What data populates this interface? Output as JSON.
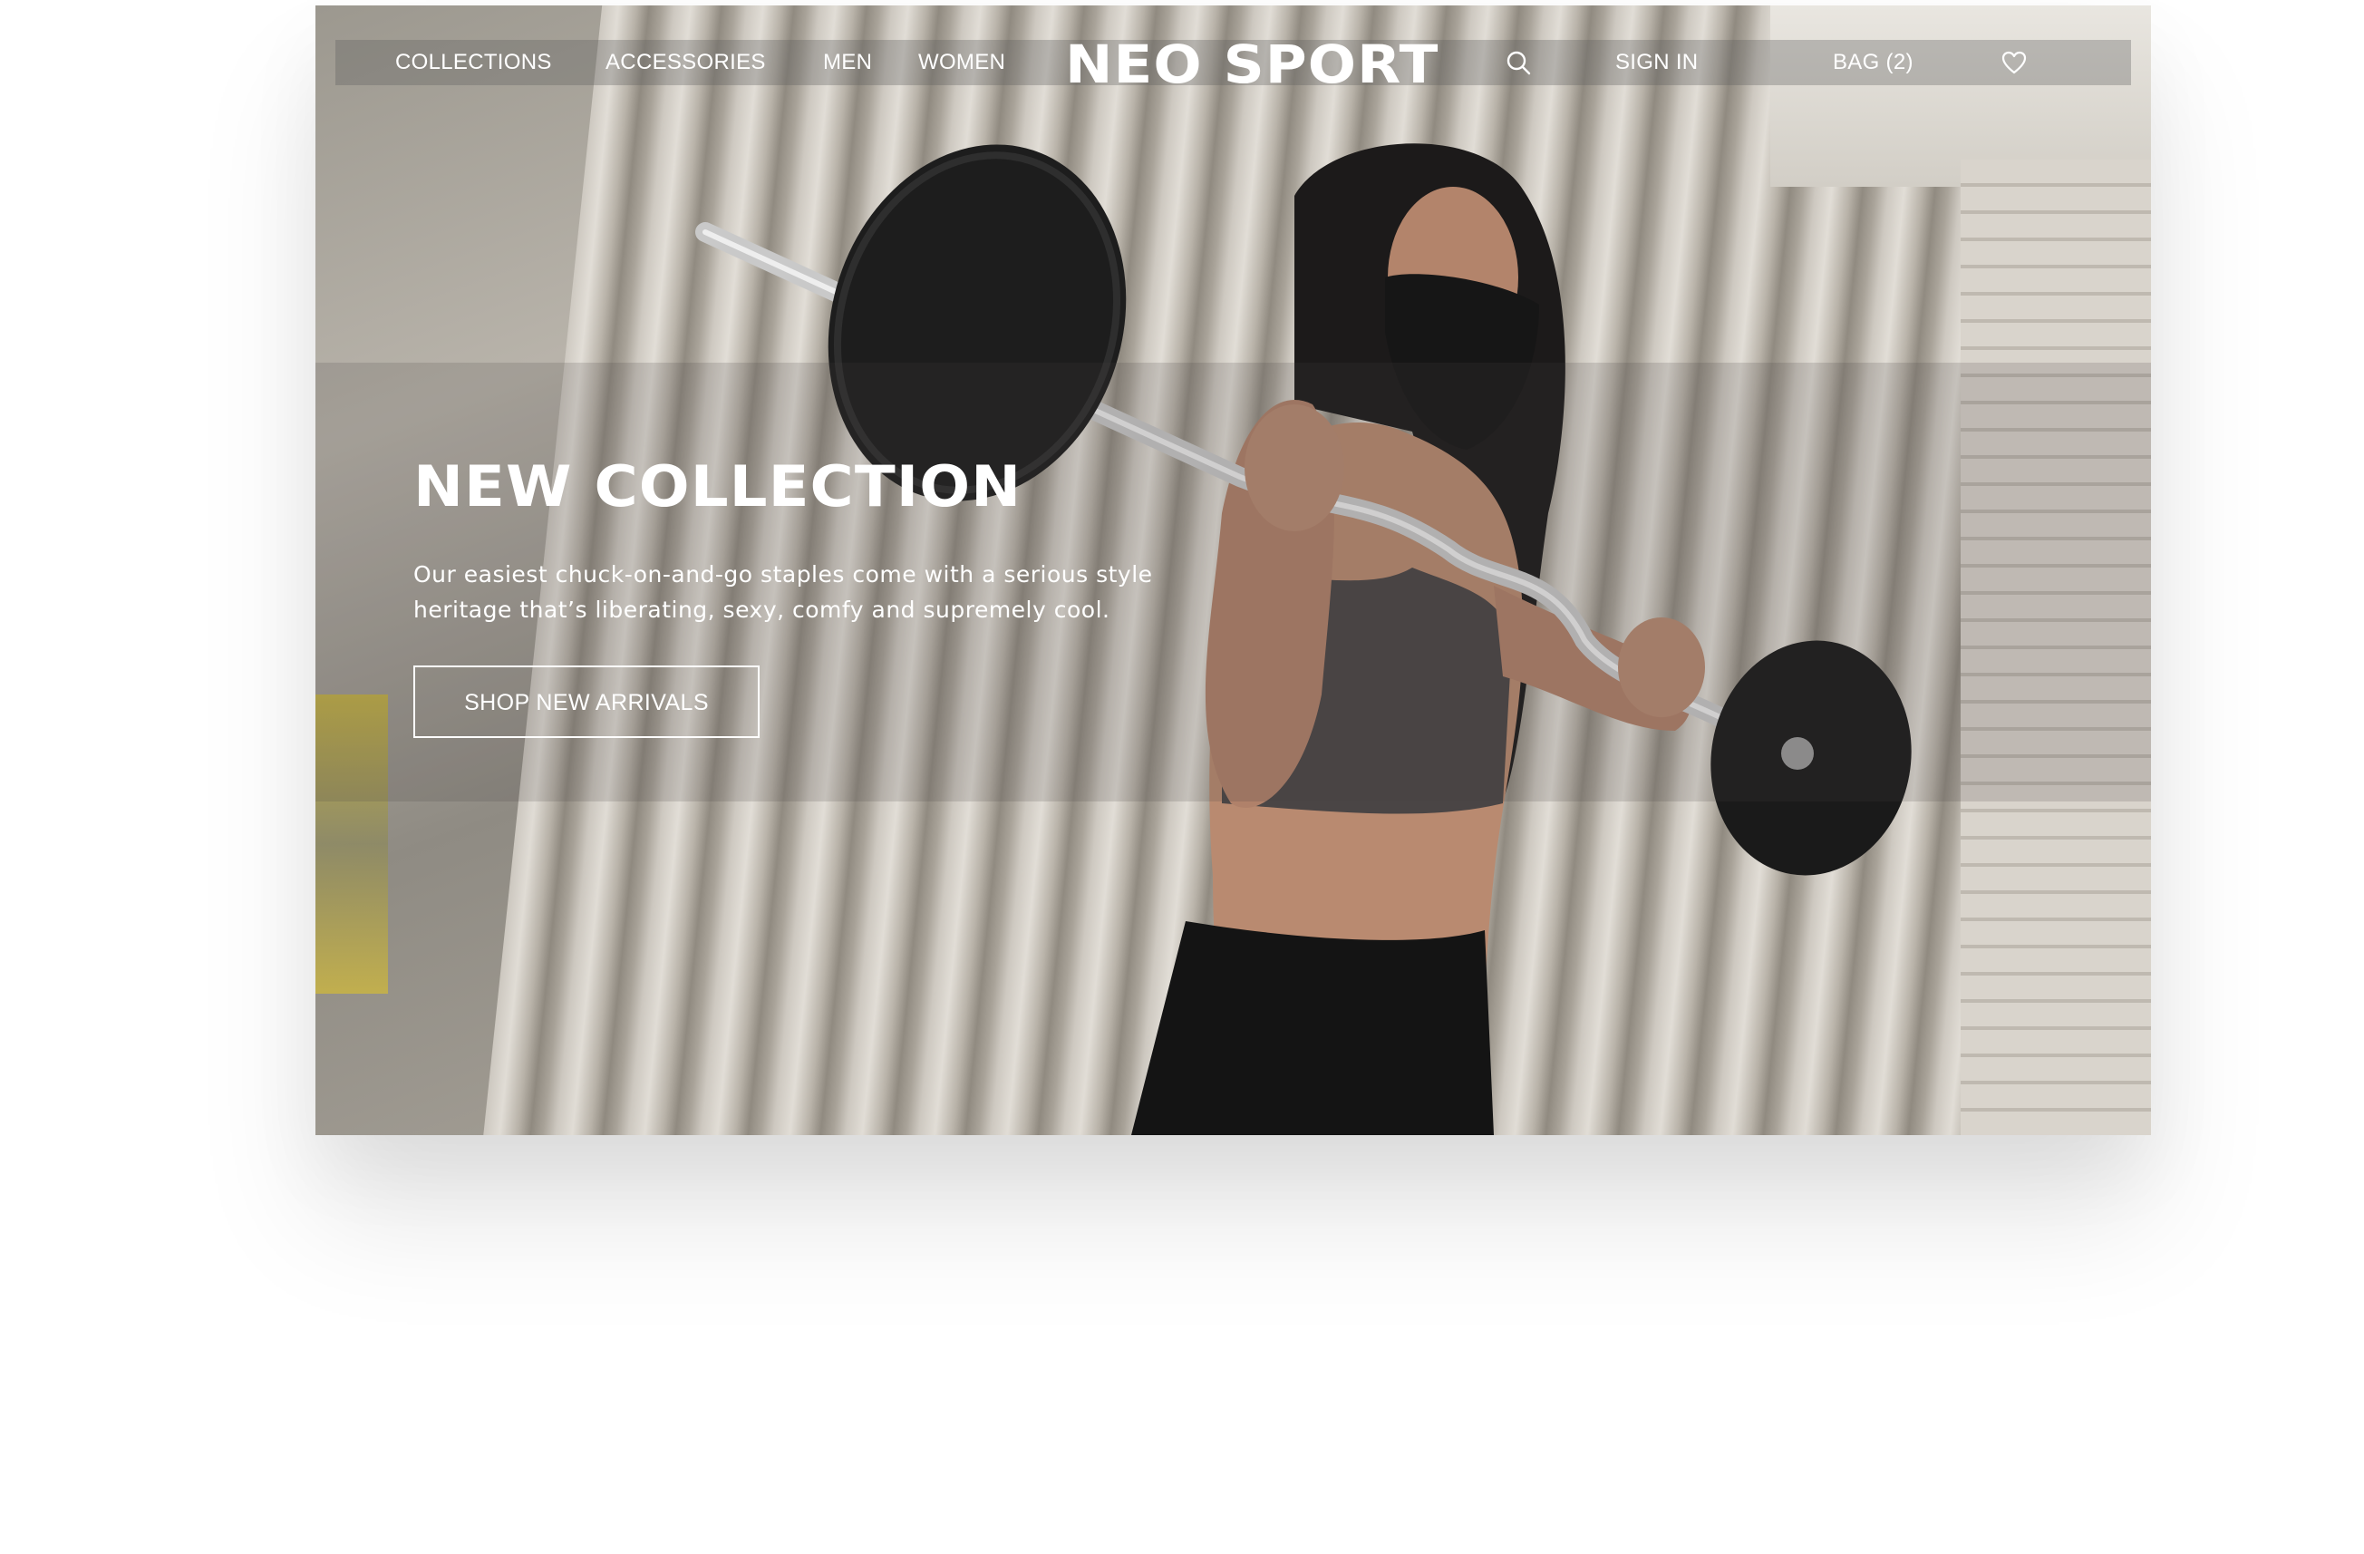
{
  "nav": {
    "collections": "COLLECTIONS",
    "accessories": "ACCESSORIES",
    "men": "MEN",
    "women": "WOMEN",
    "brand": "NEO SPORT",
    "search_icon": "search-icon",
    "sign_in": "SIGN IN",
    "bag": "BAG (2)",
    "wishlist_icon": "heart-icon"
  },
  "hero": {
    "title": "NEW COLLECTION",
    "copy_line1": "Our easiest chuck-on-and-go staples come with a serious style",
    "copy_line2": "heritage that’s liberating, sexy, comfy and supremely cool.",
    "cta": "SHOP NEW ARRIVALS"
  },
  "colors": {
    "nav_text": "#ffffff",
    "nav_bar": "#5a5a5a",
    "page_bg": "#ffffff"
  }
}
